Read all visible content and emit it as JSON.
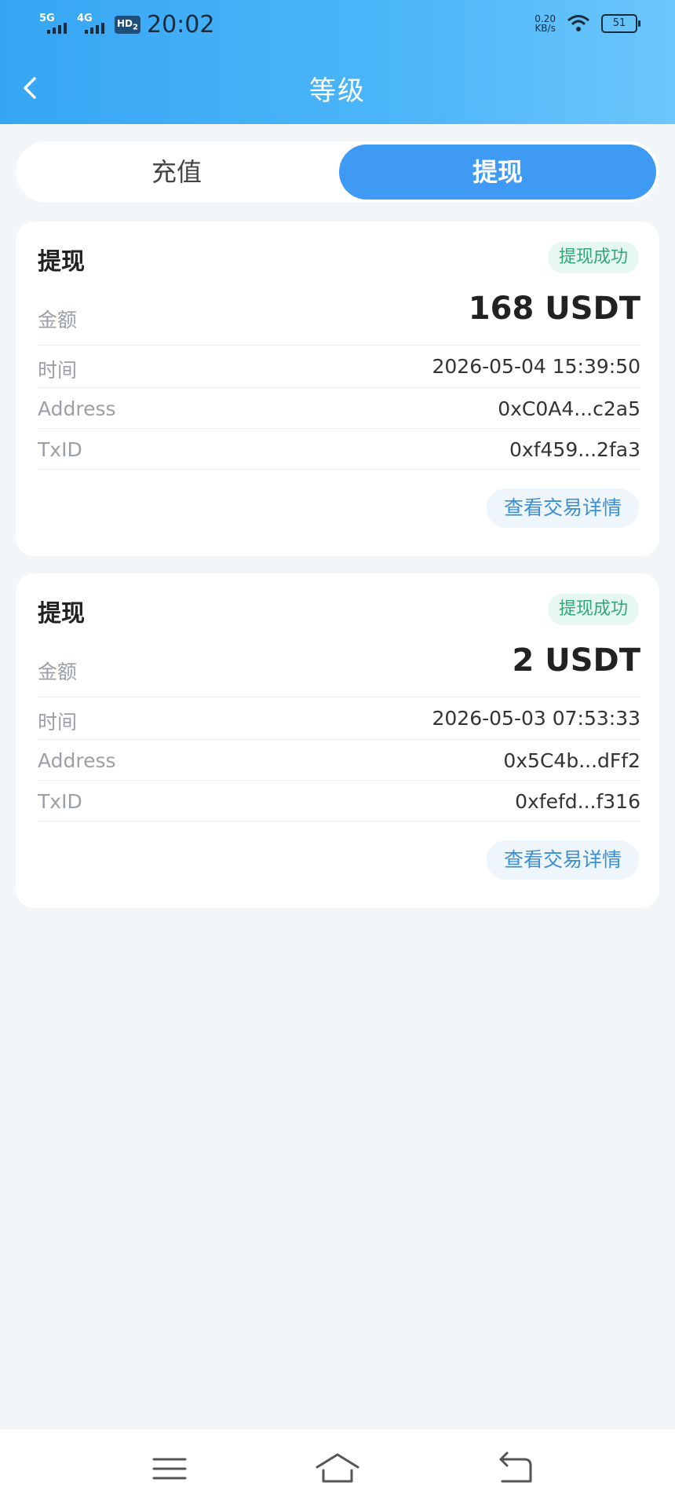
{
  "status_bar": {
    "net1": "5G",
    "net2": "4G",
    "hd": "HD",
    "hd_sub": "2",
    "time": "20:02",
    "speed_value": "0.20",
    "speed_unit": "KB/s",
    "battery": "51"
  },
  "nav": {
    "title": "等级"
  },
  "tabs": [
    {
      "label": "充值",
      "active": false
    },
    {
      "label": "提现",
      "active": true
    }
  ],
  "records": [
    {
      "title": "提现",
      "status": "提现成功",
      "amount_label": "金额",
      "amount": "168 USDT",
      "time_label": "时间",
      "time": "2026-05-04 15:39:50",
      "address_label": "Address",
      "address": "0xC0A4...c2a5",
      "txid_label": "TxID",
      "txid": "0xf459...2fa3",
      "detail_label": "查看交易详情"
    },
    {
      "title": "提现",
      "status": "提现成功",
      "amount_label": "金额",
      "amount": "2 USDT",
      "time_label": "时间",
      "time": "2026-05-03 07:53:33",
      "address_label": "Address",
      "address": "0x5C4b...dFf2",
      "txid_label": "TxID",
      "txid": "0xfefd...f316",
      "detail_label": "查看交易详情"
    }
  ],
  "colors": {
    "header_gradient_start": "#36a6f4",
    "header_gradient_end": "#6cc6fb",
    "active_tab": "#3f9af4",
    "success_badge_text": "#2fa97a",
    "success_badge_bg": "#e6f6f0",
    "detail_link": "#3a8fd6",
    "page_bg": "#f3f6f9"
  },
  "icons": {
    "back": "chevron-left-icon",
    "menu": "menu-icon",
    "home": "home-icon",
    "system_back": "return-icon"
  }
}
